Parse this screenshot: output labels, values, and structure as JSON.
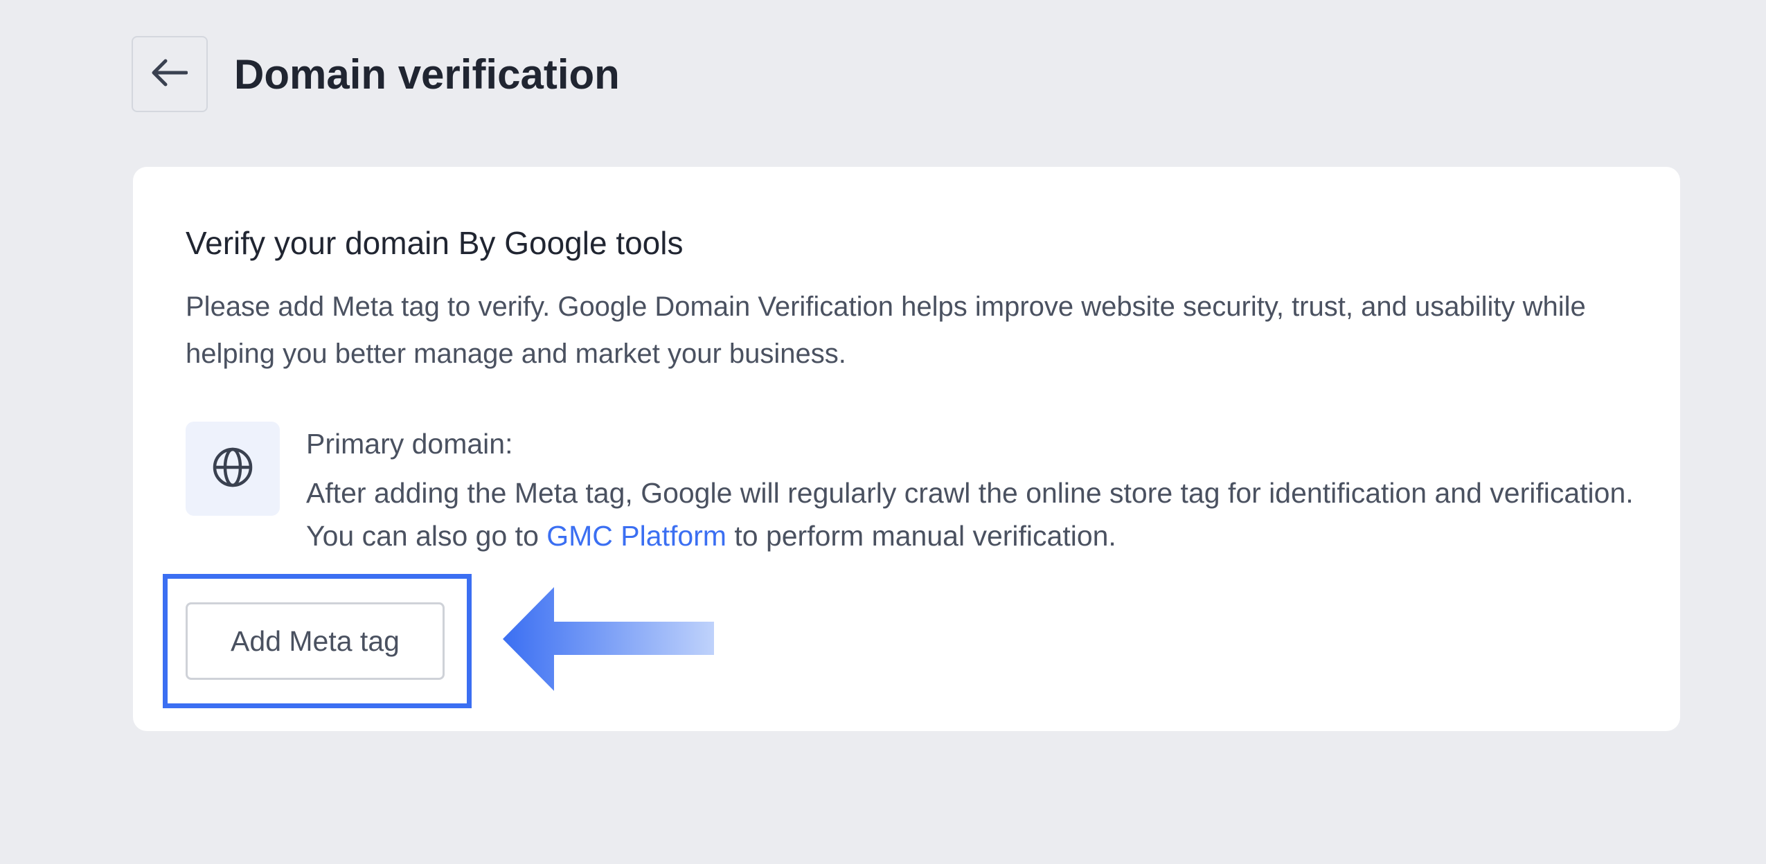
{
  "header": {
    "title": "Domain verification",
    "back_icon": "arrow-left-icon"
  },
  "card": {
    "title": "Verify your domain By Google tools",
    "description": "Please add Meta tag to verify. Google Domain Verification helps improve website security, trust, and us­ability while helping you better manage and market your business.",
    "primary_domain": {
      "icon": "globe-icon",
      "heading": "Primary domain:",
      "text_before_link": "After adding the Meta tag, Google will regularly crawl the online store tag for identification and verification. You can also go to ",
      "link_label": "GMC Platform",
      "text_after_link": " to perform manual verification."
    },
    "add_button_label": "Add Meta tag"
  },
  "annotation": {
    "highlight_color": "#3b6ff2",
    "arrow_icon": "pointer-arrow-icon"
  },
  "colors": {
    "background": "#ebecf0",
    "card": "#ffffff",
    "link": "#3b6ff2",
    "icon_tile": "#eef2fc"
  }
}
